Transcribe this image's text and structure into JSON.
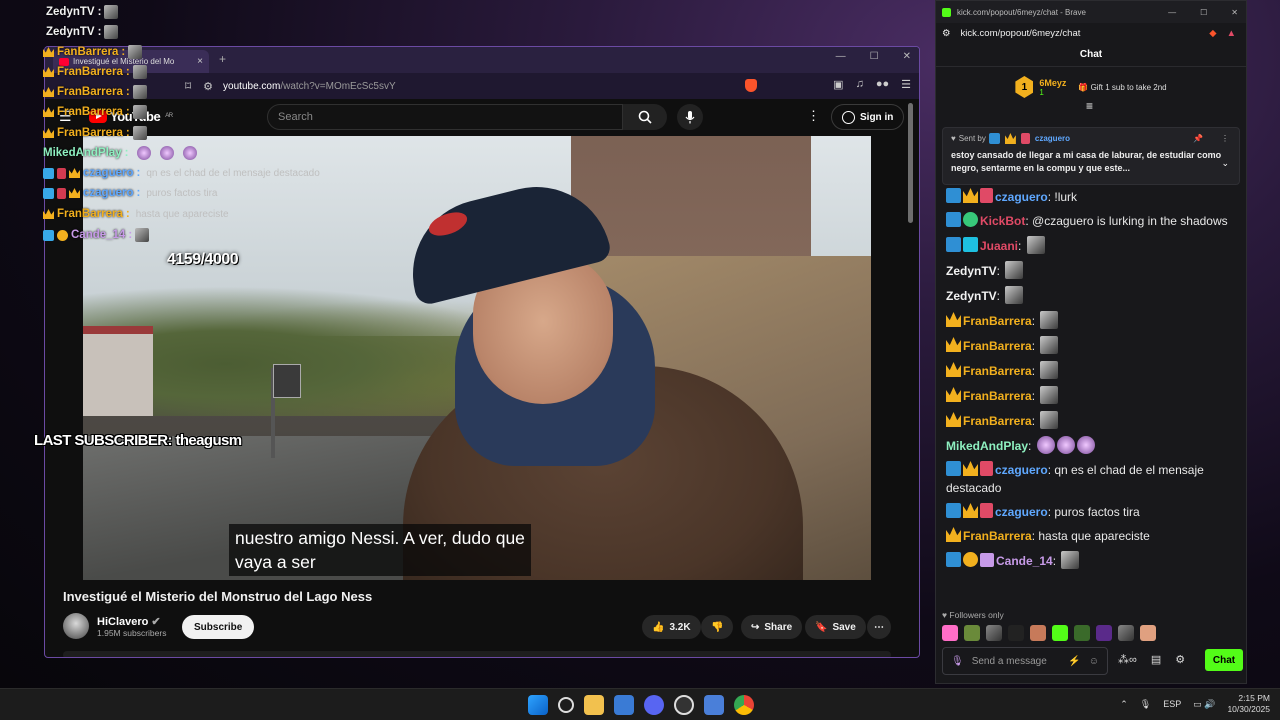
{
  "overlay": {
    "lines": [
      {
        "user": "ZedynTV",
        "color": "#f2f2f2",
        "text": ""
      },
      {
        "user": "ZedynTV",
        "color": "#f2f2f2",
        "text": ""
      },
      {
        "user": "FanBarrera",
        "color": "#f2b01e",
        "text": ""
      },
      {
        "user": "FranBarrera",
        "color": "#f2b01e",
        "text": ""
      },
      {
        "user": "FranBarrera",
        "color": "#f2b01e",
        "text": ""
      },
      {
        "user": "FranBarrera",
        "color": "#f2b01e",
        "text": ""
      },
      {
        "user": "FranBarrera",
        "color": "#f2b01e",
        "text": ""
      },
      {
        "user": "MikedAndPlay",
        "color": "#8ef0c0",
        "text": ""
      },
      {
        "user": "czaguero",
        "color": "#5fa8ff",
        "text": "qn es el chad de el mensaje destacado"
      },
      {
        "user": "czaguero",
        "color": "#5fa8ff",
        "text": "puros factos tira"
      },
      {
        "user": "FranBarrera",
        "color": "#f2b01e",
        "text": "hasta que apareciste"
      },
      {
        "user": "Cande_14",
        "color": "#c79ae8",
        "text": ""
      }
    ],
    "counter": "4159/4000",
    "last_subscriber": "LAST SUBSCRIBER: theagusm"
  },
  "yt_browser": {
    "tab_title": "Investigué el Misterio del Mo",
    "url_host": "youtube.com",
    "url_path": "/watch?v=MOmEcSc5svY",
    "search_placeholder": "Search",
    "signin": "Sign in",
    "logo_text": "YouTube",
    "logo_region": "AR",
    "subtitle_line1": "nuestro amigo Nessi. A ver, dudo que",
    "subtitle_line2": "vaya a ser",
    "video_title": "Investigué el Misterio del Monstruo del Lago Ness",
    "channel_name": "HiClavero",
    "channel_subs": "1.95M subscribers",
    "subscribe": "Subscribe",
    "likes": "3.2K",
    "share": "Share",
    "save": "Save"
  },
  "chat": {
    "window_title": "kick.com/popout/6meyz/chat - Brave",
    "url": "kick.com/popout/6meyz/chat",
    "header": "Chat",
    "gifter_name": "6Meyz",
    "gifter_count": "1",
    "gift_cta": "Gift 1 sub to take 2nd",
    "pinned_sent_by": "Sent by",
    "pinned_user": "czaguero",
    "pinned_message": "estoy cansado de llegar a mi casa de laburar, de estudiar como negro, sentarme en la compu y que este...",
    "messages": [
      {
        "user": "czaguero",
        "color": "#5fa8ff",
        "badges": [
          "sword",
          "crown",
          "red"
        ],
        "text": "!lurk",
        "emotes": 0
      },
      {
        "user": "czaguero",
        "color": "#5fa8ff",
        "badges": [
          "sword",
          "crown",
          "red"
        ],
        "text": "!lurk",
        "emotes": 0
      },
      {
        "user": "KickBot",
        "color": "#e04a66",
        "badges": [
          "sword",
          "verified"
        ],
        "text": "@czaguero is lurking in the shadows",
        "emotes": 0
      },
      {
        "user": "Juaani",
        "color": "#e04a66",
        "badges": [
          "sword",
          "og"
        ],
        "text": "",
        "emotes": 1
      },
      {
        "user": "ZedynTV",
        "color": "#f2f2f2",
        "badges": [],
        "text": "",
        "emotes": 1
      },
      {
        "user": "ZedynTV",
        "color": "#f2f2f2",
        "badges": [],
        "text": "",
        "emotes": 1
      },
      {
        "user": "FranBarrera",
        "color": "#f2b01e",
        "badges": [
          "crown"
        ],
        "text": "",
        "emotes": 1
      },
      {
        "user": "FranBarrera",
        "color": "#f2b01e",
        "badges": [
          "crown"
        ],
        "text": "",
        "emotes": 1
      },
      {
        "user": "FranBarrera",
        "color": "#f2b01e",
        "badges": [
          "crown"
        ],
        "text": "",
        "emotes": 1
      },
      {
        "user": "FranBarrera",
        "color": "#f2b01e",
        "badges": [
          "crown"
        ],
        "text": "",
        "emotes": 1
      },
      {
        "user": "FranBarrera",
        "color": "#f2b01e",
        "badges": [
          "crown"
        ],
        "text": "",
        "emotes": 1
      },
      {
        "user": "MikedAndPlay",
        "color": "#8ef0c0",
        "badges": [],
        "text": "",
        "emotes": 3
      },
      {
        "user": "czaguero",
        "color": "#5fa8ff",
        "badges": [
          "sword",
          "crown",
          "red"
        ],
        "text": "qn es el chad de el mensaje destacado",
        "emotes": 0
      },
      {
        "user": "czaguero",
        "color": "#5fa8ff",
        "badges": [
          "sword",
          "crown",
          "red"
        ],
        "text": "puros factos tira",
        "emotes": 0
      },
      {
        "user": "FranBarrera",
        "color": "#f2b01e",
        "badges": [
          "crown"
        ],
        "text": "hasta que apareciste",
        "emotes": 0
      },
      {
        "user": "Cande_14",
        "color": "#c79ae8",
        "badges": [
          "sword",
          "num",
          "gift"
        ],
        "text": "",
        "emotes": 1
      }
    ],
    "followers_only": "Followers only",
    "input_placeholder": "Send a message",
    "send": "Chat"
  },
  "taskbar": {
    "lang": "ESP",
    "time": "2:15 PM",
    "date": "10/30/2025"
  },
  "colors": {
    "kick_green": "#53fc18",
    "yt_red": "#ff0000"
  }
}
